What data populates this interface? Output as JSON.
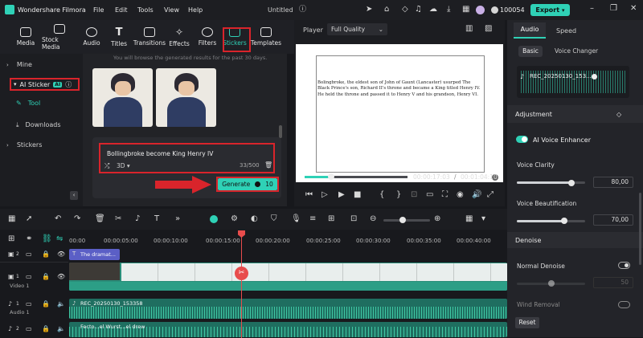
{
  "app": {
    "name": "Wondershare Filmora",
    "project": "Untitled",
    "credits": "100054",
    "export": "Export"
  },
  "menu": [
    "File",
    "Edit",
    "Tools",
    "View",
    "Help"
  ],
  "tabs": [
    "Media",
    "Stock Media",
    "Audio",
    "Titles",
    "Transitions",
    "Effects",
    "Filters",
    "Stickers",
    "Templates"
  ],
  "sidebar": {
    "mine": "Mine",
    "ai_sticker": "AI Sticker",
    "ai_badge": "AI",
    "tool": "Tool",
    "downloads": "Downloads",
    "stickers": "Stickers"
  },
  "gallery": {
    "notice": "You will browse the generated results for the past 30 days.",
    "prompt": "Bollingbroke become King Henry IV",
    "style": "3D",
    "counter": "33/500",
    "generate": "Generate",
    "cost": "10"
  },
  "player": {
    "label": "Player",
    "quality": "Full Quality",
    "text1": "Bolingbroke, the eldest son of John of Gaunt (Lancaster) usurped The Black Prince's son, Richard II's throne and became a King titled Henry IV.",
    "text2": "He held the throne and passed it to Henry V and his grandson, Henry VI.",
    "current": "00:00:17:03",
    "total": "00:01:04:10"
  },
  "right": {
    "tab_audio": "Audio",
    "tab_speed": "Speed",
    "sub_basic": "Basic",
    "sub_voice": "Voice Changer",
    "clip": "REC_20250130_153...",
    "adjustment": "Adjustment",
    "enhancer": "AI Voice Enhancer",
    "clarity": "Voice Clarity",
    "clarity_val": "80,00",
    "clarity_level": 0.8,
    "beautify": "Voice Beautification",
    "beautify_val": "70,00",
    "beautify_level": 0.7,
    "denoise": "Denoise",
    "normal_denoise": "Normal Denoise",
    "denoise_val": "50",
    "wind": "Wind Removal",
    "reset": "Reset"
  },
  "timeline": {
    "ticks": [
      "00:00",
      "00:00:05:00",
      "00:00:10:00",
      "00:00:15:00",
      "00:00:20:00",
      "00:00:25:00",
      "00:00:30:00",
      "00:00:35:00",
      "00:00:40:00"
    ],
    "title_clip": "The dramat...",
    "video_label": "Video 1",
    "audio_clip": "REC_20250130_153358",
    "audio2_clip": "Fecto...el Wurst...el drew",
    "audio_label": "Audio 1",
    "track_v2": "2",
    "track_v1": "1",
    "track_a1": "1",
    "track_a2": "2"
  }
}
